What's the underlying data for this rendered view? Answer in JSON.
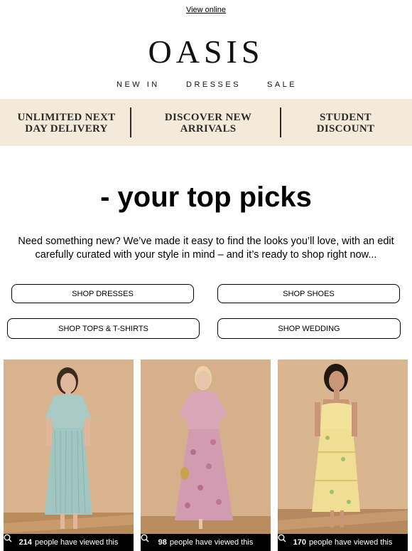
{
  "header": {
    "view_online": "View online",
    "logo": "OASIS",
    "nav": [
      "NEW IN",
      "DRESSES",
      "SALE"
    ]
  },
  "promo": {
    "items": [
      {
        "line1": "UNLIMITED NEXT",
        "line2": "DAY DELIVERY"
      },
      {
        "line1": "DISCOVER NEW",
        "line2": "ARRIVALS"
      },
      {
        "line1": "STUDENT",
        "line2": "DISCOUNT"
      }
    ],
    "background": "#f3ead9"
  },
  "main": {
    "headline": "- your top picks",
    "intro": "Need something new? We’ve made it easy to find the looks you’ll love, with an edit carefully curated with your style in mind – and it’s ready to shop right now...",
    "buttons": [
      "SHOP DRESSES",
      "SHOP SHOES",
      "SHOP TOPS & T-SHIRTS",
      "SHOP WEDDING"
    ]
  },
  "products": [
    {
      "views": "214",
      "views_suffix": "people have viewed this",
      "dress_color": "#a9cbc6",
      "icon": "search-icon"
    },
    {
      "views": "98",
      "views_suffix": "people have viewed this",
      "dress_color": "#d9a6b8",
      "icon": "search-icon"
    },
    {
      "views": "170",
      "views_suffix": "people have viewed this",
      "dress_color": "#f2e39a",
      "icon": "search-icon"
    }
  ]
}
